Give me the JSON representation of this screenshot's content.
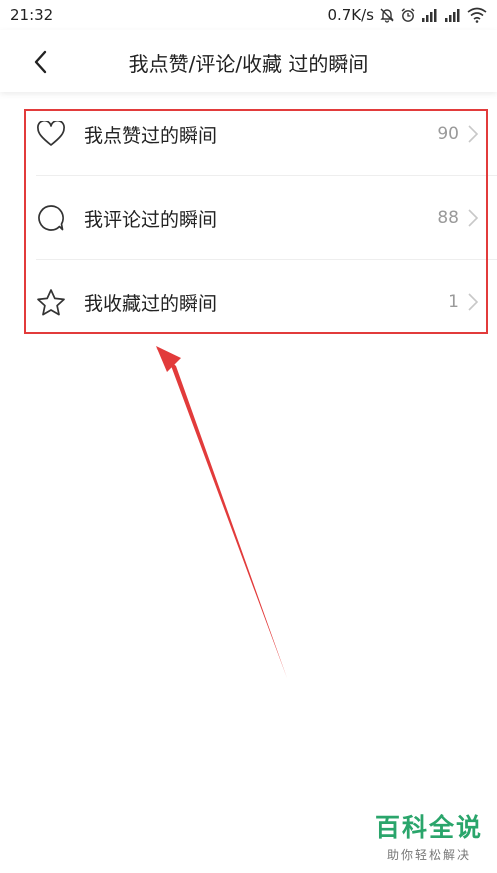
{
  "status_bar": {
    "time": "21:32",
    "speed": "0.7K/s",
    "icons": [
      "mute-bell-icon",
      "alarm-icon",
      "signal-icon",
      "signal-icon",
      "wifi-icon"
    ]
  },
  "header": {
    "title": "我点赞/评论/收藏 过的瞬间",
    "back_icon": "chevron-left-icon"
  },
  "list": {
    "items": [
      {
        "label": "我点赞过的瞬间",
        "count": "90",
        "icon": "heart-icon"
      },
      {
        "label": "我评论过的瞬间",
        "count": "88",
        "icon": "comment-icon"
      },
      {
        "label": "我收藏过的瞬间",
        "count": "1",
        "icon": "star-icon"
      }
    ]
  },
  "annotation": {
    "color": "#e23b3b"
  },
  "watermark": {
    "main": "百科全说",
    "sub": "助你轻松解决",
    "color": "#2aa56b"
  }
}
